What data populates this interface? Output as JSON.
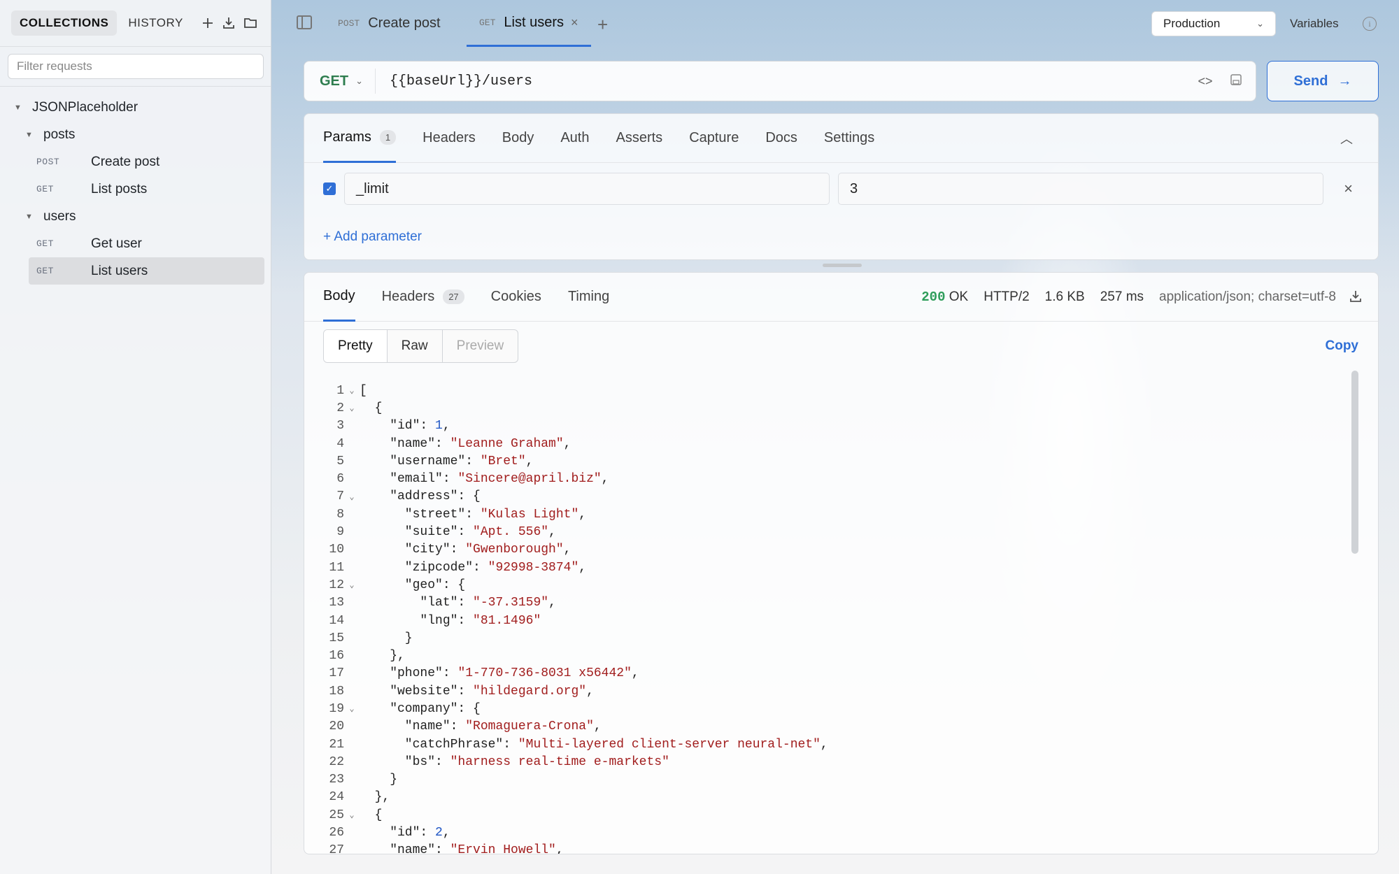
{
  "sidebar": {
    "tabs": [
      "COLLECTIONS",
      "HISTORY"
    ],
    "filter_placeholder": "Filter requests",
    "tree": {
      "collection": "JSONPlaceholder",
      "folders": [
        {
          "name": "posts",
          "requests": [
            {
              "method": "POST",
              "name": "Create post"
            },
            {
              "method": "GET",
              "name": "List posts"
            }
          ]
        },
        {
          "name": "users",
          "requests": [
            {
              "method": "GET",
              "name": "Get user"
            },
            {
              "method": "GET",
              "name": "List users"
            }
          ]
        }
      ]
    }
  },
  "tabs": [
    {
      "method": "POST",
      "label": "Create post"
    },
    {
      "method": "GET",
      "label": "List users"
    }
  ],
  "environment": {
    "selected": "Production",
    "variables_label": "Variables"
  },
  "request": {
    "method": "GET",
    "url": "{{baseUrl}}/users",
    "send_label": "Send",
    "tabs": [
      "Params",
      "Headers",
      "Body",
      "Auth",
      "Asserts",
      "Capture",
      "Docs",
      "Settings"
    ],
    "params_count": "1",
    "params": [
      {
        "key": "_limit",
        "value": "3",
        "enabled": true
      }
    ],
    "add_param_label": "+ Add parameter"
  },
  "response": {
    "tabs": [
      "Body",
      "Headers",
      "Cookies",
      "Timing"
    ],
    "headers_count": "27",
    "status_code": "200",
    "status_text": "OK",
    "protocol": "HTTP/2",
    "size": "1.6 KB",
    "time": "257 ms",
    "content_type": "application/json; charset=utf-8",
    "view_modes": [
      "Pretty",
      "Raw",
      "Preview"
    ],
    "copy_label": "Copy",
    "lines": [
      {
        "n": "1",
        "f": true,
        "t": "["
      },
      {
        "n": "2",
        "f": true,
        "t": "  {"
      },
      {
        "n": "3",
        "f": false,
        "t": "    \"id\": ",
        "v": "1",
        "vt": "num",
        "e": ","
      },
      {
        "n": "4",
        "f": false,
        "t": "    \"name\": ",
        "v": "\"Leanne Graham\"",
        "vt": "str",
        "e": ","
      },
      {
        "n": "5",
        "f": false,
        "t": "    \"username\": ",
        "v": "\"Bret\"",
        "vt": "str",
        "e": ","
      },
      {
        "n": "6",
        "f": false,
        "t": "    \"email\": ",
        "v": "\"Sincere@april.biz\"",
        "vt": "str",
        "e": ","
      },
      {
        "n": "7",
        "f": true,
        "t": "    \"address\": {"
      },
      {
        "n": "8",
        "f": false,
        "t": "      \"street\": ",
        "v": "\"Kulas Light\"",
        "vt": "str",
        "e": ","
      },
      {
        "n": "9",
        "f": false,
        "t": "      \"suite\": ",
        "v": "\"Apt. 556\"",
        "vt": "str",
        "e": ","
      },
      {
        "n": "10",
        "f": false,
        "t": "      \"city\": ",
        "v": "\"Gwenborough\"",
        "vt": "str",
        "e": ","
      },
      {
        "n": "11",
        "f": false,
        "t": "      \"zipcode\": ",
        "v": "\"92998-3874\"",
        "vt": "str",
        "e": ","
      },
      {
        "n": "12",
        "f": true,
        "t": "      \"geo\": {"
      },
      {
        "n": "13",
        "f": false,
        "t": "        \"lat\": ",
        "v": "\"-37.3159\"",
        "vt": "str",
        "e": ","
      },
      {
        "n": "14",
        "f": false,
        "t": "        \"lng\": ",
        "v": "\"81.1496\"",
        "vt": "str",
        "e": ""
      },
      {
        "n": "15",
        "f": false,
        "t": "      }"
      },
      {
        "n": "16",
        "f": false,
        "t": "    },"
      },
      {
        "n": "17",
        "f": false,
        "t": "    \"phone\": ",
        "v": "\"1-770-736-8031 x56442\"",
        "vt": "str",
        "e": ","
      },
      {
        "n": "18",
        "f": false,
        "t": "    \"website\": ",
        "v": "\"hildegard.org\"",
        "vt": "str",
        "e": ","
      },
      {
        "n": "19",
        "f": true,
        "t": "    \"company\": {"
      },
      {
        "n": "20",
        "f": false,
        "t": "      \"name\": ",
        "v": "\"Romaguera-Crona\"",
        "vt": "str",
        "e": ","
      },
      {
        "n": "21",
        "f": false,
        "t": "      \"catchPhrase\": ",
        "v": "\"Multi-layered client-server neural-net\"",
        "vt": "str",
        "e": ","
      },
      {
        "n": "22",
        "f": false,
        "t": "      \"bs\": ",
        "v": "\"harness real-time e-markets\"",
        "vt": "str",
        "e": ""
      },
      {
        "n": "23",
        "f": false,
        "t": "    }"
      },
      {
        "n": "24",
        "f": false,
        "t": "  },"
      },
      {
        "n": "25",
        "f": true,
        "t": "  {"
      },
      {
        "n": "26",
        "f": false,
        "t": "    \"id\": ",
        "v": "2",
        "vt": "num",
        "e": ","
      },
      {
        "n": "27",
        "f": false,
        "t": "    \"name\": ",
        "v": "\"Ervin Howell\"",
        "vt": "str",
        "e": ","
      }
    ]
  }
}
